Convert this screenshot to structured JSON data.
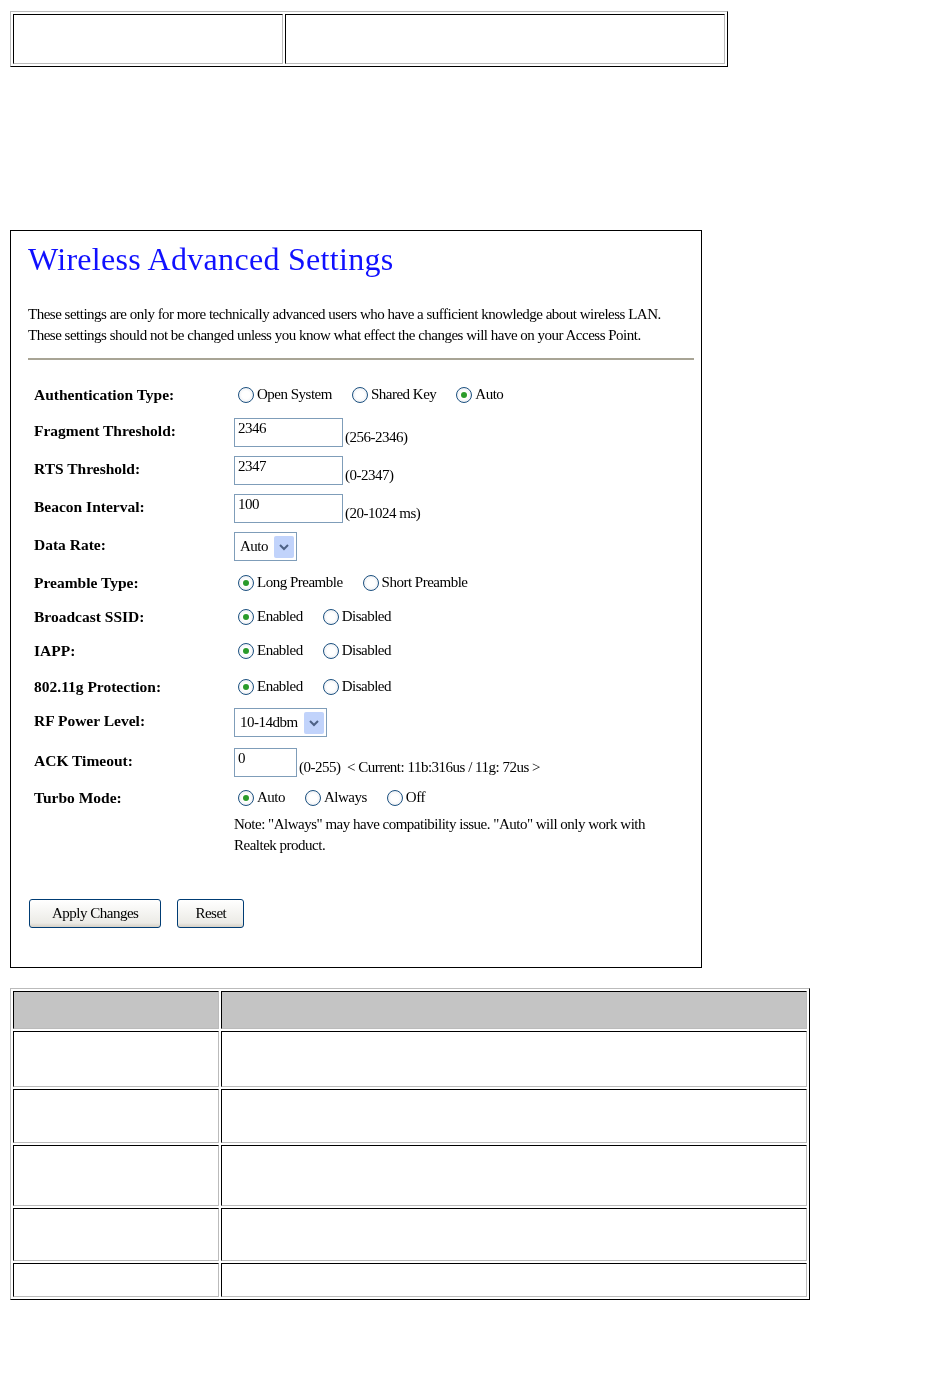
{
  "panel": {
    "title": "Wireless Advanced Settings",
    "intro": "These settings are only for more technically advanced users who have a sufficient knowledge about wireless LAN. These settings should not be changed unless you know what effect the changes will have on your Access Point.",
    "settings": [
      {
        "kind": "radio",
        "label": "Authentication Type:",
        "options": [
          {
            "label": "Open System",
            "selected": false
          },
          {
            "label": "Shared Key",
            "selected": false
          },
          {
            "label": "Auto",
            "selected": true
          }
        ]
      },
      {
        "kind": "text",
        "label": "Fragment Threshold:",
        "value": "2346",
        "hint": "(256-2346)"
      },
      {
        "kind": "text",
        "label": "RTS Threshold:",
        "value": "2347",
        "hint": "(0-2347)"
      },
      {
        "kind": "text",
        "label": "Beacon Interval:",
        "value": "100",
        "hint": "(20-1024 ms)"
      },
      {
        "kind": "select",
        "label": "Data Rate:",
        "value": "Auto"
      },
      {
        "kind": "radio",
        "label": "Preamble Type:",
        "options": [
          {
            "label": "Long Preamble",
            "selected": true
          },
          {
            "label": "Short Preamble",
            "selected": false
          }
        ]
      },
      {
        "kind": "radio",
        "label": "Broadcast SSID:",
        "options": [
          {
            "label": "Enabled",
            "selected": true
          },
          {
            "label": "Disabled",
            "selected": false
          }
        ]
      },
      {
        "kind": "radio",
        "label": "IAPP:",
        "options": [
          {
            "label": "Enabled",
            "selected": true
          },
          {
            "label": "Disabled",
            "selected": false
          }
        ]
      },
      {
        "kind": "radio",
        "label": "802.11g Protection:",
        "options": [
          {
            "label": "Enabled",
            "selected": true
          },
          {
            "label": "Disabled",
            "selected": false
          }
        ]
      },
      {
        "kind": "select",
        "label": "RF Power Level:",
        "value": "10-14dbm"
      },
      {
        "kind": "short-text",
        "label": "ACK Timeout:",
        "value": "0",
        "hint": "(0-255)  < Current: 11b:316us / 11g: 72us >"
      },
      {
        "kind": "radio",
        "label": "Turbo Mode:",
        "options": [
          {
            "label": "Auto",
            "selected": true
          },
          {
            "label": "Always",
            "selected": false
          },
          {
            "label": "Off",
            "selected": false
          }
        ],
        "note": "Note: \"Always\" may have compatibility issue. \"Auto\" will only work with Realtek product."
      }
    ],
    "buttons": [
      "Apply Changes",
      "Reset"
    ]
  }
}
